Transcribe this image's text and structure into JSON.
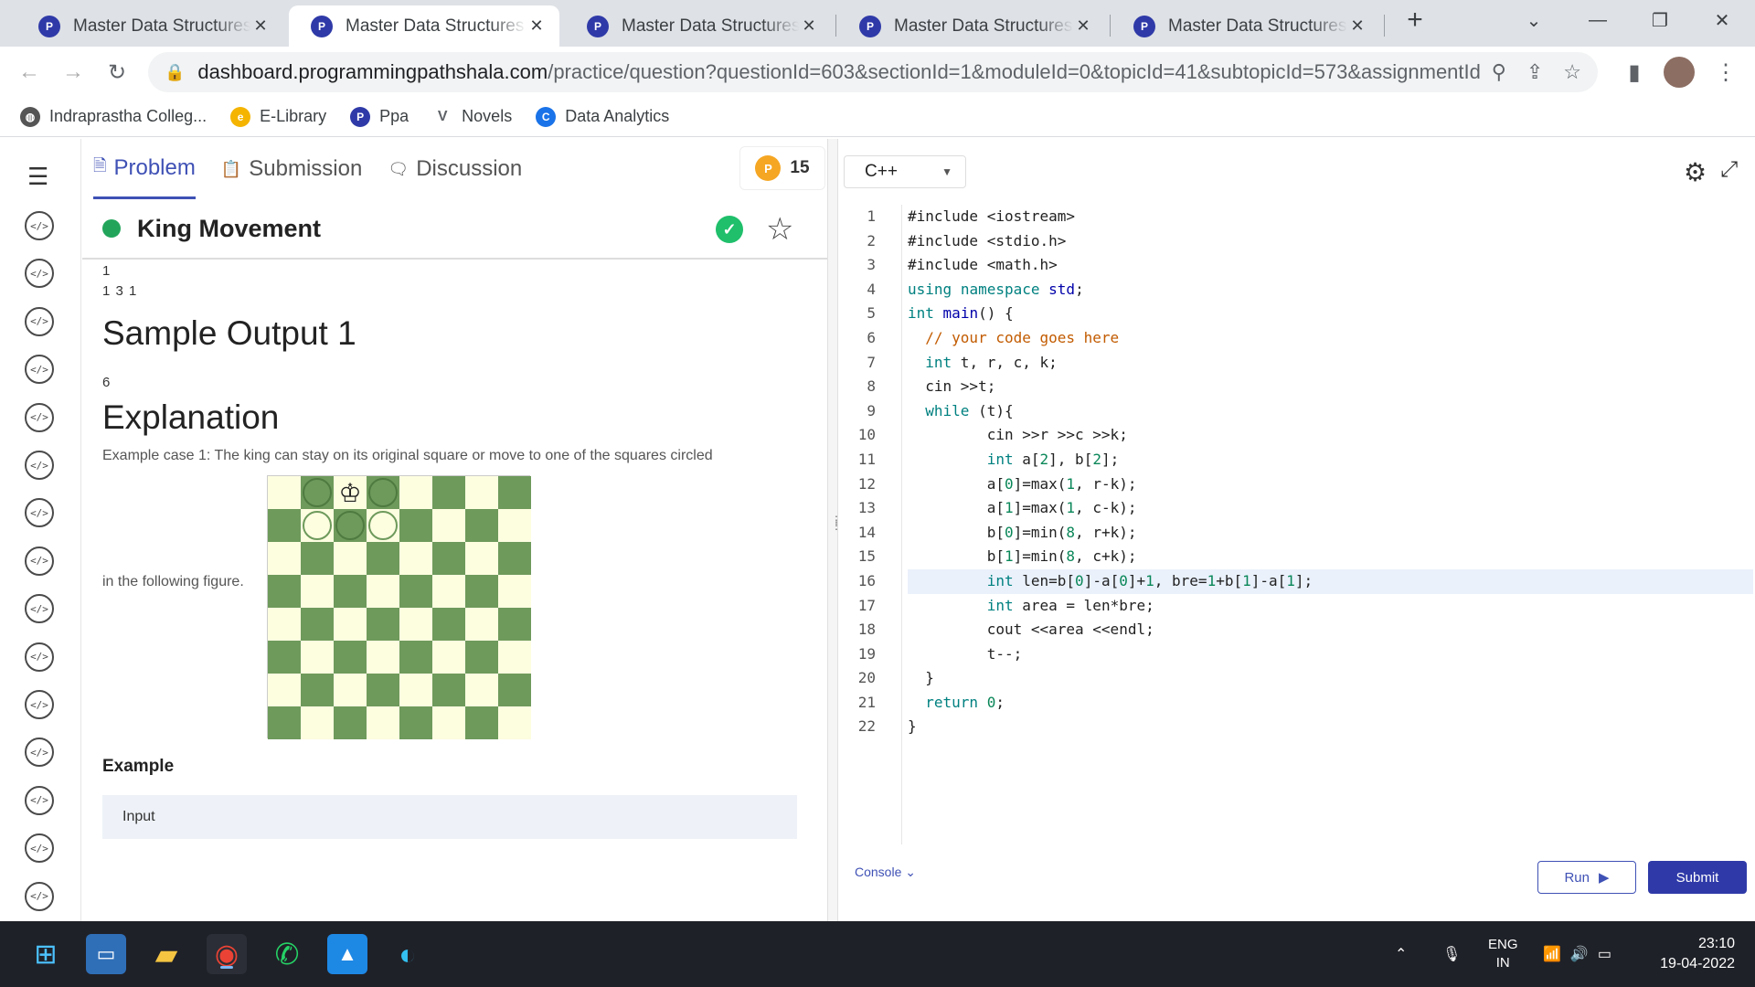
{
  "browser": {
    "tabs": [
      {
        "title": "Master Data Structures, Al"
      },
      {
        "title": "Master Data Structures, Al"
      },
      {
        "title": "Master Data Structures, A"
      },
      {
        "title": "Master Data Structures, A"
      },
      {
        "title": "Master Data Structures, A"
      }
    ],
    "new_tab": "+",
    "url_host": "dashboard.programmingpathshala.com",
    "url_path": "/practice/question?questionId=603&sectionId=1&moduleId=0&topicId=41&subtopicId=573&assignmentId...",
    "bookmarks": [
      {
        "label": "Indraprastha Colleg...",
        "color": "#555555"
      },
      {
        "label": "E-Library",
        "color": "#f4b400"
      },
      {
        "label": "Ppa",
        "color": "#2f3aa8"
      },
      {
        "label": "Novels",
        "color": "#5f6368"
      },
      {
        "label": "Data Analytics",
        "color": "#1a73e8"
      }
    ]
  },
  "problem_tabs": [
    {
      "label": "Problem"
    },
    {
      "label": "Submission"
    },
    {
      "label": "Discussion"
    }
  ],
  "coins": "15",
  "problem": {
    "title": "King Movement",
    "input_line1": "1",
    "input_line2": "1 3 1",
    "sample_output_heading": "Sample Output 1",
    "sample_output": "6",
    "explanation_heading": "Explanation",
    "explanation_text": "Example case 1: The king can stay on its original square or move to one of the squares circled",
    "explanation_tail": "in the following figure.",
    "example_heading": "Example",
    "input_label": "Input"
  },
  "editor": {
    "language": "C++",
    "lines": [
      "#include <iostream>",
      "#include <stdio.h>",
      "#include <math.h>",
      "using namespace std;",
      "int main() {",
      "  // your code goes here",
      "  int t, r, c, k;",
      "  cin >>t;",
      "  while (t){",
      "         cin >>r >>c >>k;",
      "         int a[2], b[2];",
      "         a[0]=max(1, r-k);",
      "         a[1]=max(1, c-k);",
      "         b[0]=min(8, r+k);",
      "         b[1]=min(8, c+k);",
      "         int len=b[0]-a[0]+1, bre=1+b[1]-a[1];",
      "         int area = len*bre;",
      "         cout <<area <<endl;",
      "         t--;",
      "  }",
      "  return 0;",
      "}"
    ],
    "highlight_line": 16,
    "console_label": "Console",
    "run_label": "Run",
    "submit_label": "Submit"
  },
  "taskbar": {
    "lang_line1": "ENG",
    "lang_line2": "IN",
    "time": "23:10",
    "date": "19-04-2022"
  }
}
